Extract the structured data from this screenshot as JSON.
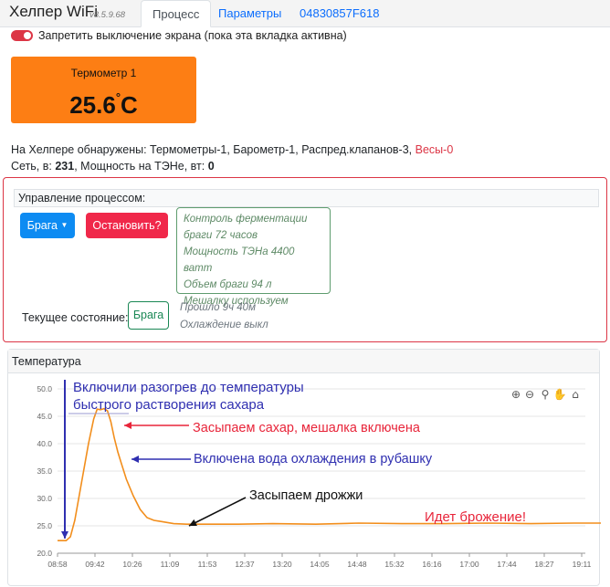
{
  "nav": {
    "brand": "Хелпер WiFi",
    "version": "v8.5.9.68",
    "tabs": [
      {
        "label": "Процесс",
        "active": true
      },
      {
        "label": "Параметры",
        "active": false
      },
      {
        "label": "04830857F618",
        "active": false
      }
    ]
  },
  "screen_toggle": {
    "label": "Запретить выключение экрана (пока эта вкладка активна)",
    "on": true
  },
  "thermometer": {
    "title": "Термометр 1",
    "value": "25.6",
    "unit": "C",
    "color": "#fd7e14"
  },
  "info": {
    "detected_prefix": "На Хелпере обнаружены: Термометры-1, Барометр-1, Распред.клапанов-3,",
    "detected_warn": "Весы-0",
    "net_label": "Сеть, в:",
    "net_value": "231",
    "power_label": ", Мощность на ТЭНе, вт:",
    "power_value": "0"
  },
  "process": {
    "header": "Управление процессом:",
    "mode_button": "Брага",
    "stop_button": "Остановить?",
    "details": [
      "Контроль ферментации",
      "браги 72 часов",
      "Мощность ТЭНа 4400 ватт",
      "Объем браги 94 л",
      "Мешалку используем"
    ],
    "state_label": "Текущее состояние:",
    "state_value": "Брага",
    "elapsed": "Прошло 9ч 40м",
    "cooling": "Охлаждение выкл"
  },
  "chart_title": "Температура",
  "chart_data": {
    "type": "line",
    "ylim": [
      20.0,
      50.0
    ],
    "yticks": [
      "20.0",
      "25.0",
      "30.0",
      "35.0",
      "40.0",
      "45.0",
      "50.0"
    ],
    "xticks": [
      "08:58",
      "09:42",
      "10:26",
      "11:09",
      "11:53",
      "12:37",
      "13:20",
      "14:05",
      "14:48",
      "15:32",
      "16:16",
      "17:00",
      "17:44",
      "18:27",
      "19:11"
    ],
    "series": [
      {
        "color": "#f28e1c",
        "x_minutes": [
          0,
          10,
          15,
          20,
          28,
          36,
          42,
          46,
          50,
          54,
          58,
          62,
          66,
          70,
          74,
          80,
          88,
          96,
          104,
          112,
          120,
          135,
          150,
          165,
          180,
          210,
          250,
          300,
          350,
          400,
          450,
          500,
          550,
          600,
          650,
          700,
          750,
          780
        ],
        "values": [
          22.3,
          22.3,
          23.0,
          26.0,
          33.0,
          40.0,
          44.5,
          46.3,
          46.2,
          46.4,
          46.0,
          44.0,
          41.0,
          38.5,
          36.5,
          33.5,
          30.5,
          28.0,
          26.5,
          26.0,
          25.8,
          25.4,
          25.3,
          25.3,
          25.3,
          25.3,
          25.4,
          25.3,
          25.5,
          25.4,
          25.4,
          25.5,
          25.4,
          25.5,
          25.5,
          25.6,
          25.6,
          25.6
        ]
      }
    ],
    "annotations": [
      {
        "text": "Включили разогрев до температуры",
        "color": "#2f2fb0"
      },
      {
        "text": "быстрого растворения сахара",
        "color": "#2f2fb0"
      },
      {
        "text": "Засыпаем сахар, мешалка включена",
        "color": "#e8253a"
      },
      {
        "text": "Включена вода охлаждения в рубашку",
        "color": "#2f2fb0"
      },
      {
        "text": "Засыпаем дрожжи",
        "color": "#111111"
      },
      {
        "text": "Идет брожение!",
        "color": "#e8253a"
      }
    ],
    "grid": true
  }
}
